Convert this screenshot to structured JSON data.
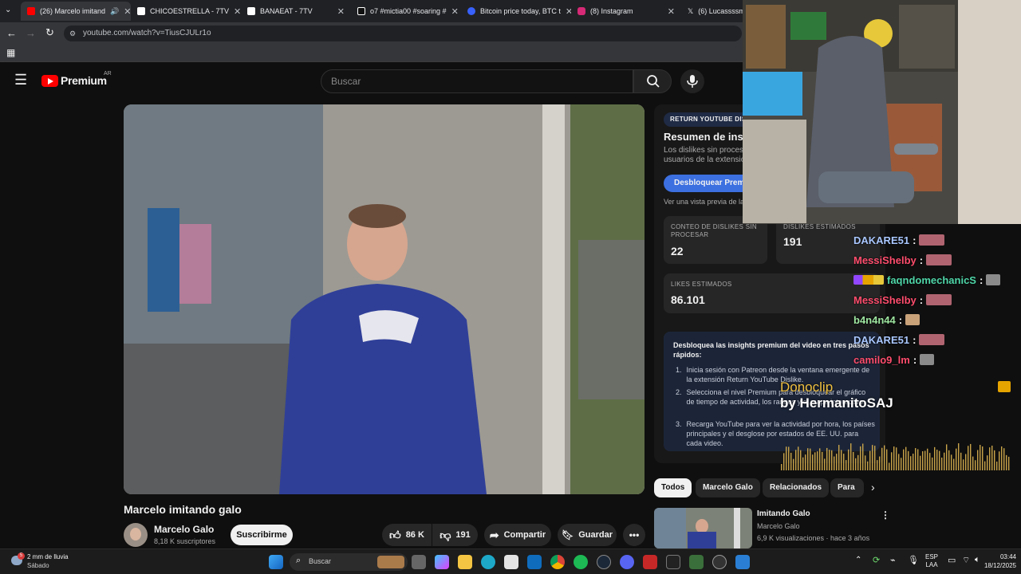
{
  "tabs": [
    {
      "label": "(26) Marcelo imitand",
      "icon": "youtube-icon",
      "color": "#ff0000",
      "active": true
    },
    {
      "label": "CHICOESTRELLA - 7TV",
      "icon": "7tv-icon",
      "color": "#ffffff"
    },
    {
      "label": "BANAEAT - 7TV",
      "icon": "7tv-icon",
      "color": "#ffffff"
    },
    {
      "label": "o7 #mictia00 #soaring #",
      "icon": "tiktok-icon",
      "color": "#ffffff"
    },
    {
      "label": "Bitcoin price today, BTC t",
      "icon": "coinmarketcap-icon",
      "color": "#3861fb"
    },
    {
      "label": "(8) Instagram",
      "icon": "instagram-icon",
      "color": "#d62976"
    },
    {
      "label": "(6) Lucassssm",
      "icon": "x-icon",
      "color": "#ffffff"
    }
  ],
  "address": {
    "url": "youtube.com/watch?v=TiusCJULr1o"
  },
  "yt": {
    "logo_text": "Premium",
    "region": "AR",
    "search_placeholder": "Buscar"
  },
  "video": {
    "title": "Marcelo imitando galo",
    "channel": "Marcelo Galo",
    "subscribers": "8,18 K suscriptores",
    "subscribe_label": "Suscribirme",
    "likes": "86 K",
    "dislikes": "191",
    "share_label": "Compartir",
    "save_label": "Guardar"
  },
  "ryd": {
    "badge": "RETURN YOUTUBE DIS",
    "heading": "Resumen de insi",
    "desc_line1": "Los dislikes sin proces",
    "desc_line2": "usuarios de la extensió",
    "unlock_button": "Desbloquear Premi",
    "preview_text": "Ver una vista previa de la",
    "stats": [
      {
        "label": "CONTEO DE DISLIKES SIN PROCESAR",
        "value": "22"
      },
      {
        "label": "DISLIKES ESTIMADOS",
        "value": "191"
      },
      {
        "label": "LIKES ESTIMADOS",
        "value": "86.101"
      }
    ],
    "insights_title": "Desbloquea las insights premium del video en tres pasos rápidos:",
    "steps": [
      {
        "num": "1.",
        "text": "Inicia sesión con Patreon desde la ventana emergente de la extensión Return YouTube Dislike."
      },
      {
        "num": "2.",
        "text": "Selecciona el nivel Premium para desbloquear el gráfico de tiempo de actividad, los rangos y el mapa interactivo."
      },
      {
        "num": "3.",
        "text": "Recarga YouTube para ver la actividad por hora, los países principales y el desglose por estados de EE. UU. para cada video."
      }
    ]
  },
  "chat": [
    {
      "user": "DAKARE51",
      "color": "#a9c7ff",
      "emote": true
    },
    {
      "user": "MessiShelby",
      "color": "#ff4d6d",
      "emote": true
    },
    {
      "user": "faqndomechanicS",
      "color": "#4fd6a8",
      "emote": true,
      "badges": true
    },
    {
      "user": "MessiShelby",
      "color": "#ff4d6d",
      "emote": true
    },
    {
      "user": "b4n4n44",
      "color": "#9ee6a0",
      "emote": true
    },
    {
      "user": "DAKARE51",
      "color": "#a9c7ff",
      "emote": true
    },
    {
      "user": "camilo9_lm",
      "color": "#ff4d6d",
      "emote": true
    }
  ],
  "donoclip": {
    "title": "Donoclip",
    "by": "by HermanitoSAJ"
  },
  "chips": [
    "Todos",
    "Marcelo Galo",
    "Relacionados",
    "Para"
  ],
  "related": {
    "title": "Imitando Galo",
    "channel": "Marcelo Galo",
    "meta": "6,9 K visualizaciones · hace 3 años"
  },
  "taskbar": {
    "weather_temp": "2 mm de lluvia",
    "weather_day": "Sábado",
    "weather_badge": "5",
    "search_label": "Buscar",
    "lang_line1": "ESP",
    "lang_line2": "LAA",
    "time": "03:44",
    "date": "18/12/2025"
  }
}
